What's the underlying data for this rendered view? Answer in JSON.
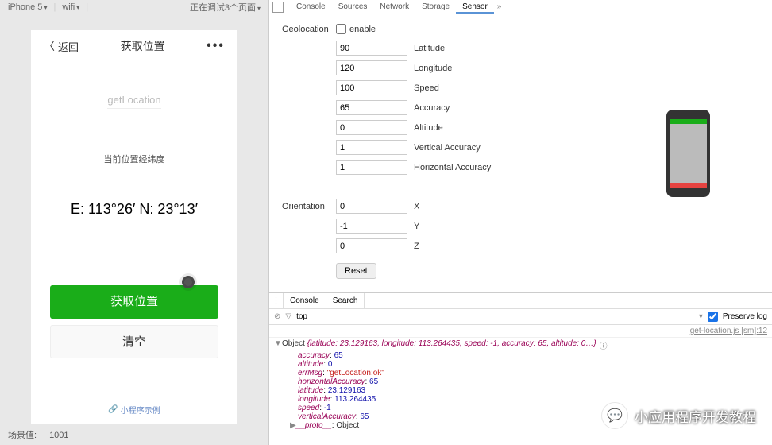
{
  "simulator": {
    "device": "iPhone 5",
    "network": "wifi",
    "debug_info": "正在调试3个页面",
    "back_label": "返回",
    "page_title": "获取位置",
    "api_name": "getLocation",
    "current_label": "当前位置经纬度",
    "coordinates": "E: 113°26′ N: 23°13′",
    "btn_get": "获取位置",
    "btn_clear": "清空",
    "footer_link": "小程序示例",
    "scene_label": "场景值:",
    "scene_value": "1001"
  },
  "devtools": {
    "tabs": [
      "Console",
      "Sources",
      "Network",
      "Storage",
      "Sensor"
    ],
    "active_tab": "Sensor",
    "geolocation": {
      "label": "Geolocation",
      "enable_label": "enable",
      "fields": [
        {
          "value": "90",
          "label": "Latitude"
        },
        {
          "value": "120",
          "label": "Longitude"
        },
        {
          "value": "100",
          "label": "Speed"
        },
        {
          "value": "65",
          "label": "Accuracy"
        },
        {
          "value": "0",
          "label": "Altitude"
        },
        {
          "value": "1",
          "label": "Vertical Accuracy"
        },
        {
          "value": "1",
          "label": "Horizontal Accuracy"
        }
      ]
    },
    "orientation": {
      "label": "Orientation",
      "fields": [
        {
          "value": "0",
          "label": "X"
        },
        {
          "value": "-1",
          "label": "Y"
        },
        {
          "value": "0",
          "label": "Z"
        }
      ],
      "reset_label": "Reset"
    }
  },
  "console": {
    "tabs": [
      "Console",
      "Search"
    ],
    "context": "top",
    "preserve_label": "Preserve log",
    "preserve_checked": true,
    "source_link": "get-location.js [sm]:12",
    "object_head": "Object",
    "object_summary": "{latitude: 23.129163, longitude: 113.264435, speed: -1, accuracy: 65, altitude: 0…}",
    "props": [
      {
        "k": "accuracy",
        "v": "65",
        "t": "num"
      },
      {
        "k": "altitude",
        "v": "0",
        "t": "num"
      },
      {
        "k": "errMsg",
        "v": "\"getLocation:ok\"",
        "t": "str"
      },
      {
        "k": "horizontalAccuracy",
        "v": "65",
        "t": "num"
      },
      {
        "k": "latitude",
        "v": "23.129163",
        "t": "num"
      },
      {
        "k": "longitude",
        "v": "113.264435",
        "t": "num"
      },
      {
        "k": "speed",
        "v": "-1",
        "t": "num"
      },
      {
        "k": "verticalAccuracy",
        "v": "65",
        "t": "num"
      }
    ],
    "proto_label": "__proto__",
    "proto_val": "Object"
  },
  "watermark": "小应用程序开发教程"
}
